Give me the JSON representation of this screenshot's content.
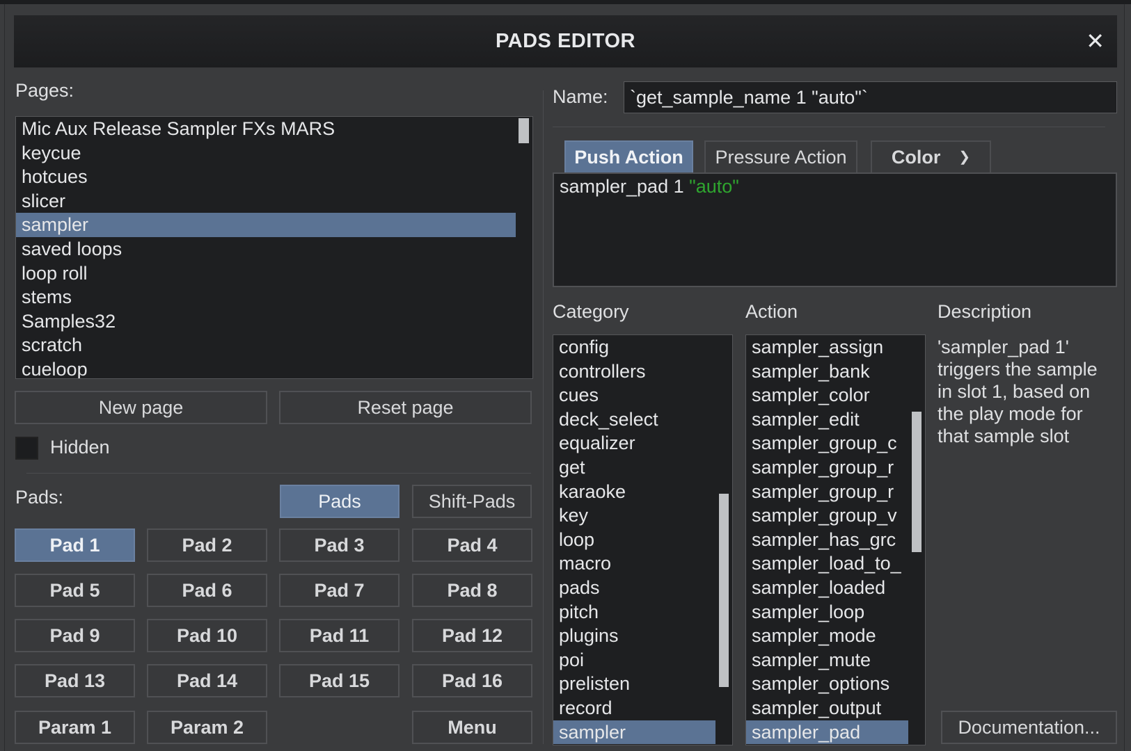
{
  "dialog": {
    "title": "PADS EDITOR"
  },
  "pages": {
    "label": "Pages:",
    "items": [
      "Mic Aux Release Sampler FXs MARS",
      "keycue",
      "hotcues",
      "slicer",
      "sampler",
      "saved loops",
      "loop roll",
      "stems",
      "Samples32",
      "scratch",
      "cueloop"
    ],
    "selected": "sampler",
    "new_page_label": "New page",
    "reset_page_label": "Reset page",
    "hidden_label": "Hidden",
    "hidden_checked": false
  },
  "pads": {
    "label": "Pads:",
    "pads_toggle": "Pads",
    "shift_pads_toggle": "Shift-Pads",
    "buttons": [
      "Pad 1",
      "Pad 2",
      "Pad 3",
      "Pad 4",
      "Pad 5",
      "Pad 6",
      "Pad 7",
      "Pad 8",
      "Pad 9",
      "Pad 10",
      "Pad 11",
      "Pad 12",
      "Pad 13",
      "Pad 14",
      "Pad 15",
      "Pad 16"
    ],
    "selected": "Pad 1",
    "param1": "Param 1",
    "param2": "Param 2",
    "menu": "Menu"
  },
  "editor": {
    "name_label": "Name:",
    "name_value": "`get_sample_name 1 \"auto\"`",
    "tabs": {
      "push": "Push Action",
      "pressure": "Pressure Action",
      "color": "Color"
    },
    "active_tab": "Push Action",
    "script_part1": "sampler_pad 1 ",
    "script_string": "\"auto\""
  },
  "browser": {
    "category_label": "Category",
    "action_label": "Action",
    "description_label": "Description",
    "categories": [
      "config",
      "controllers",
      "cues",
      "deck_select",
      "equalizer",
      "get",
      "karaoke",
      "key",
      "loop",
      "macro",
      "pads",
      "pitch",
      "plugins",
      "poi",
      "prelisten",
      "record",
      "sampler"
    ],
    "selected_category": "sampler",
    "actions": [
      "sampler_assign",
      "sampler_bank",
      "sampler_color",
      "sampler_edit",
      "sampler_group_c",
      "sampler_group_r",
      "sampler_group_r",
      "sampler_group_v",
      "sampler_has_grc",
      "sampler_load_to_",
      "sampler_loaded",
      "sampler_loop",
      "sampler_mode",
      "sampler_mute",
      "sampler_options",
      "sampler_output",
      "sampler_pad"
    ],
    "selected_action": "sampler_pad",
    "description": "'sampler_pad 1' triggers the sample in slot 1, based on the play mode for that sample slot",
    "documentation_button": "Documentation..."
  },
  "colors": {
    "accent": "#5b7394",
    "string_green": "#2fa52f",
    "background": "#3a3b3d",
    "field": "#1e1f21"
  }
}
